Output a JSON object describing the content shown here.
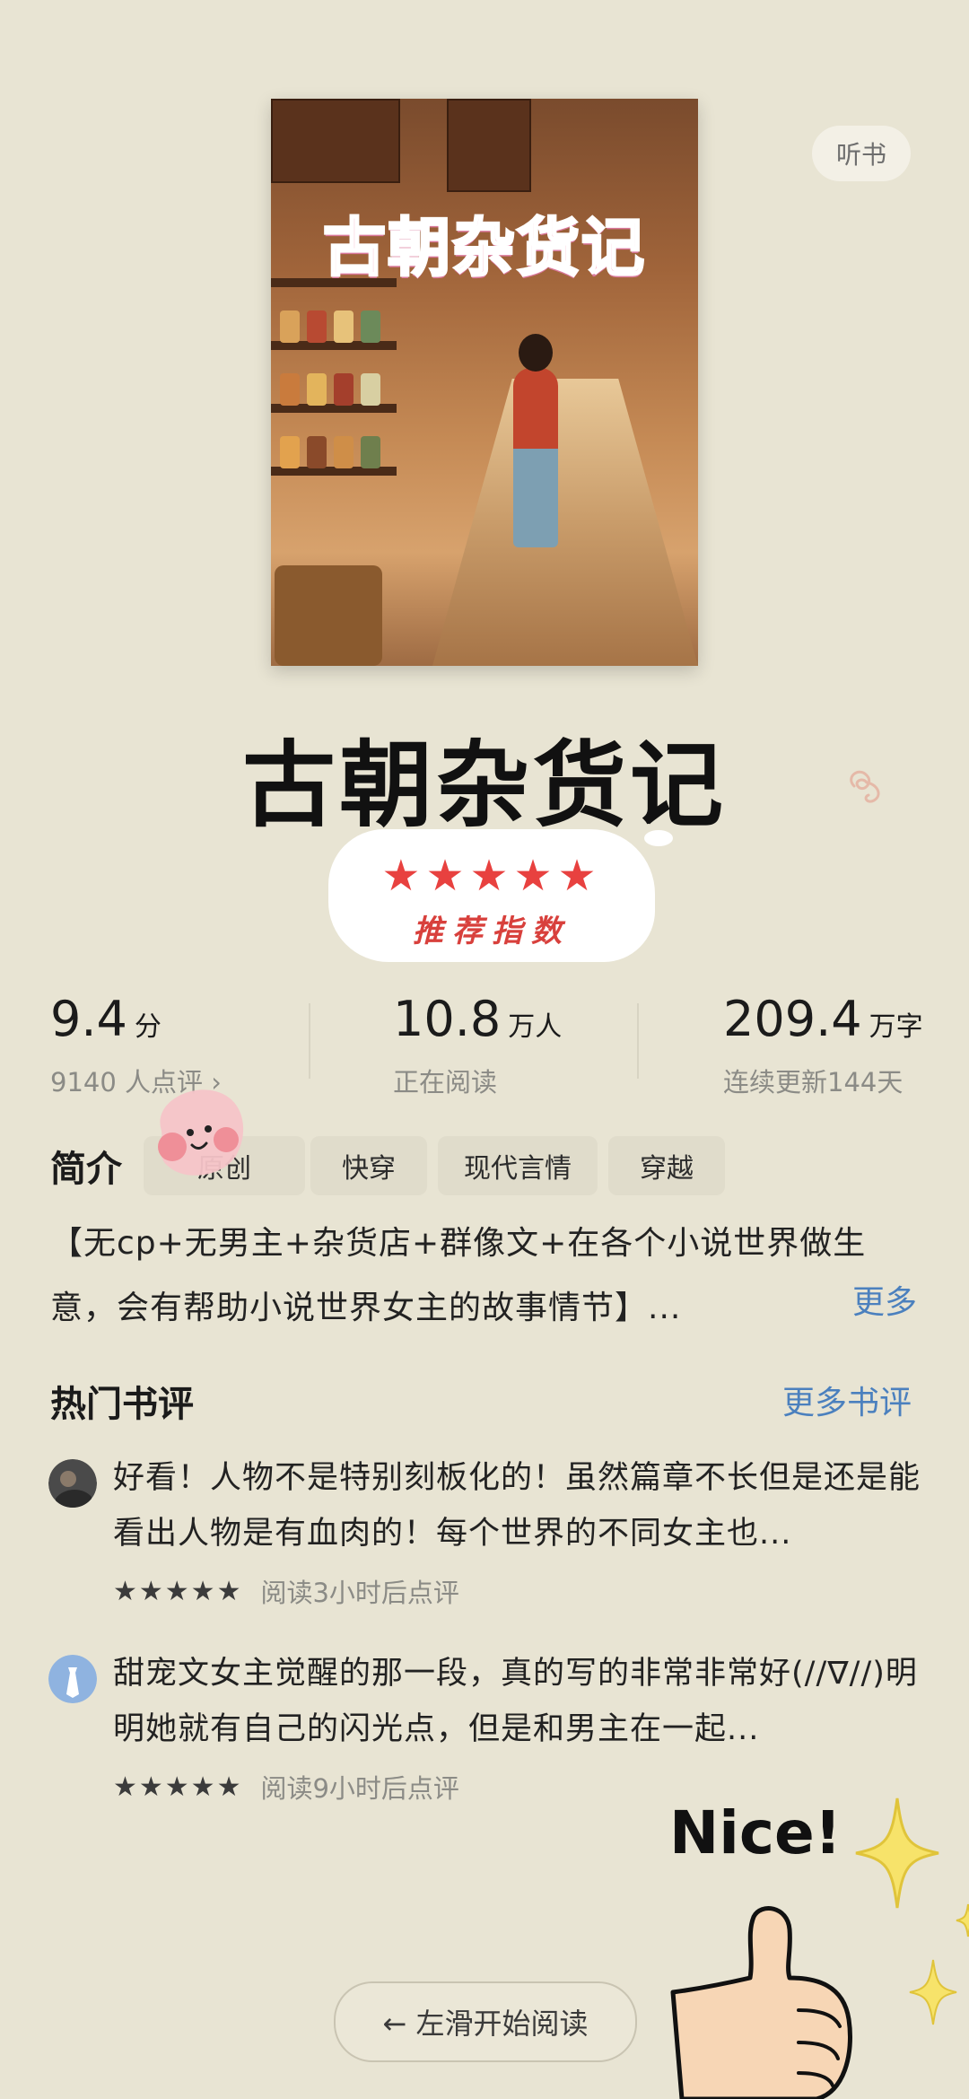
{
  "header": {
    "listen_label": "听书"
  },
  "cover": {
    "title_art": "古朝杂货记"
  },
  "book": {
    "title": "古朝杂货记"
  },
  "recommend": {
    "stars": "★★★★★",
    "label": "推荐指数",
    "rating": 5
  },
  "stats": {
    "score": {
      "value": "9.4",
      "unit": "分",
      "sub": "9140 人点评 ›"
    },
    "readers": {
      "value": "10.8",
      "unit": "万人",
      "sub": "正在阅读"
    },
    "words": {
      "value": "209.4",
      "unit": "万字",
      "sub": "连续更新144天"
    }
  },
  "intro": {
    "label": "简介",
    "tags": [
      "原创",
      "快穿",
      "现代言情",
      "穿越"
    ],
    "text": "【无cp+无男主+杂货店+群像文+在各个小说世界做生意，会有帮助小说世界女主的故事情节】...",
    "more": "更多"
  },
  "reviews": {
    "title": "热门书评",
    "more": "更多书评",
    "items": [
      {
        "text": "好看！人物不是特别刻板化的！虽然篇章不长但是还是能看出人物是有血肉的！每个世界的不同女主也...",
        "stars": "★★★★★",
        "meta": "阅读3小时后点评"
      },
      {
        "text": "甜宠文女主觉醒的那一段，真的写的非常非常好(//∇//)明明她就有自己的闪光点，但是和男主在一起...",
        "stars": "★★★★★",
        "meta": "阅读9小时后点评"
      }
    ]
  },
  "bottom": {
    "read_button": "← 左滑开始阅读",
    "sticker_text": "Nice!"
  },
  "colors": {
    "background": "#e8e4d3",
    "link": "#4b80be",
    "star_red": "#e8413f"
  }
}
